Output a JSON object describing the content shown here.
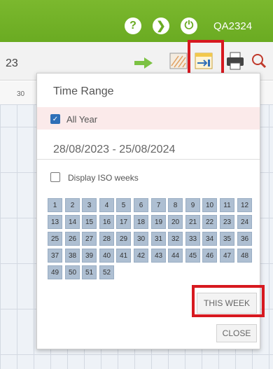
{
  "header": {
    "help_glyph": "?",
    "next_glyph": "❯",
    "power_glyph": "⏻",
    "user_code": "QA2324",
    "colors": {
      "bar": "#6aab22",
      "highlight": "#d71920"
    }
  },
  "toolbar": {
    "year_fragment": "23"
  },
  "grid": {
    "day_label": "30"
  },
  "popup": {
    "title": "Time Range",
    "all_year_label": "All Year",
    "all_year_checked": true,
    "date_range": "28/08/2023 - 25/08/2024",
    "iso_label": "Display ISO weeks",
    "iso_checked": false,
    "weeks": [
      "1",
      "2",
      "3",
      "4",
      "5",
      "6",
      "7",
      "8",
      "9",
      "10",
      "11",
      "12",
      "13",
      "14",
      "15",
      "16",
      "17",
      "18",
      "19",
      "20",
      "21",
      "22",
      "23",
      "24",
      "25",
      "26",
      "27",
      "28",
      "29",
      "30",
      "31",
      "32",
      "33",
      "34",
      "35",
      "36",
      "37",
      "38",
      "39",
      "40",
      "41",
      "42",
      "43",
      "44",
      "45",
      "46",
      "47",
      "48",
      "49",
      "50",
      "51",
      "52"
    ],
    "this_week_label": "THIS WEEK",
    "close_label": "CLOSE"
  }
}
